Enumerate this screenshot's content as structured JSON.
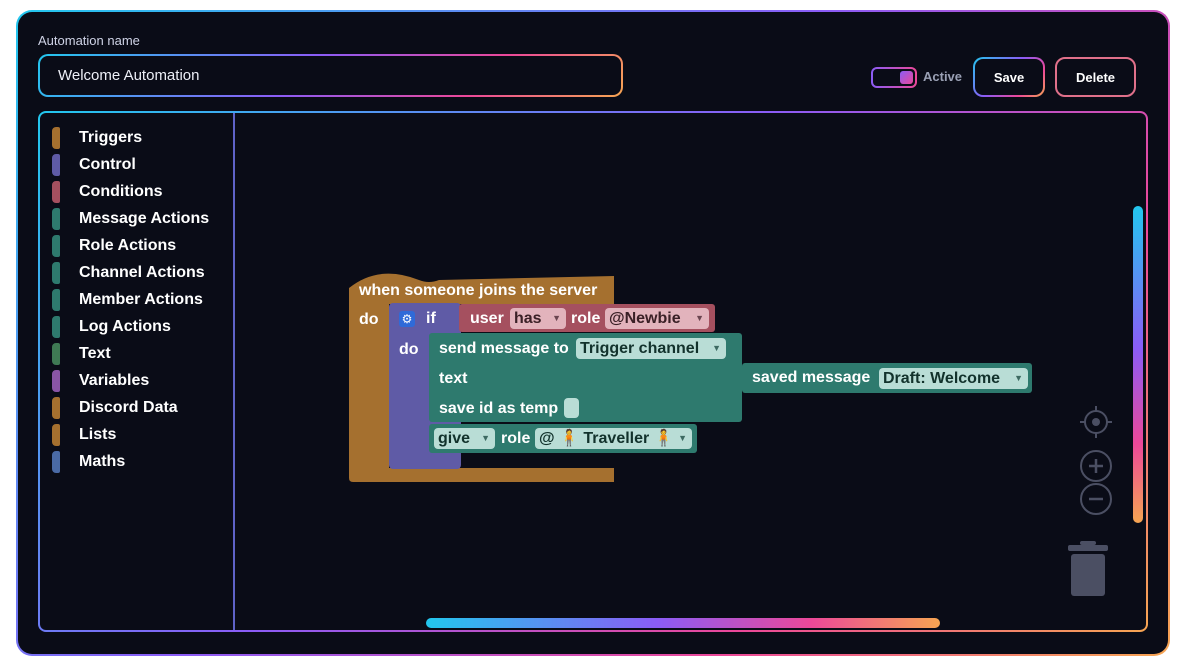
{
  "form": {
    "name_label": "Automation name",
    "name_value": "Welcome Automation",
    "active_label": "Active",
    "active": true,
    "save_label": "Save",
    "delete_label": "Delete"
  },
  "toolbox": {
    "categories": [
      {
        "label": "Triggers",
        "color": "#a5702f"
      },
      {
        "label": "Control",
        "color": "#5f5ba6"
      },
      {
        "label": "Conditions",
        "color": "#a5505f"
      },
      {
        "label": "Message Actions",
        "color": "#2e7a6e"
      },
      {
        "label": "Role Actions",
        "color": "#2e7a6e"
      },
      {
        "label": "Channel Actions",
        "color": "#2e7a6e"
      },
      {
        "label": "Member Actions",
        "color": "#2e7a6e"
      },
      {
        "label": "Log Actions",
        "color": "#2e7a6e"
      },
      {
        "label": "Text",
        "color": "#3f7a54"
      },
      {
        "label": "Variables",
        "color": "#8a55a6"
      },
      {
        "label": "Discord Data",
        "color": "#a5702f"
      },
      {
        "label": "Lists",
        "color": "#a5702f"
      },
      {
        "label": "Maths",
        "color": "#4a6aa5"
      }
    ]
  },
  "blocks": {
    "trigger": {
      "title": "when someone joins the server",
      "do": "do",
      "color": "#a5702f"
    },
    "if_block": {
      "if": "if",
      "do": "do",
      "color": "#5f5ba6"
    },
    "condition": {
      "user": "user",
      "has": "has",
      "role": "role",
      "role_value": "@Newbie",
      "color": "#a5505f"
    },
    "send_message": {
      "label": "send message to",
      "channel": "Trigger channel",
      "text": "text",
      "save_id": "save id as temp",
      "color": "#2e7a6e"
    },
    "saved_message": {
      "label": "saved message",
      "value": "Draft: Welcome"
    },
    "give_role": {
      "give": "give",
      "role": "role",
      "role_value": "@ 🧍 Traveller 🧍"
    }
  },
  "workspace": {
    "icons": [
      "crosshair-icon",
      "zoom-in-icon",
      "zoom-out-icon",
      "trash-icon"
    ]
  }
}
